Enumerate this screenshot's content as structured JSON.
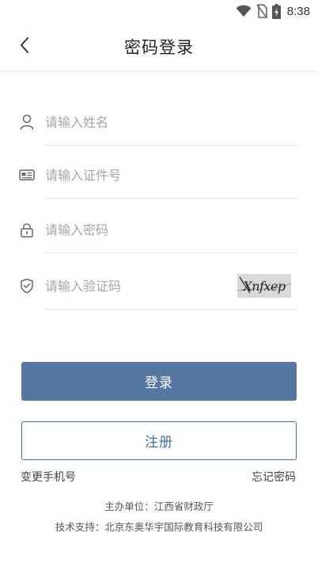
{
  "status_bar": {
    "time": "8:38",
    "icons": [
      "wifi-icon",
      "no-sim-icon",
      "battery-charging-icon"
    ]
  },
  "header": {
    "back_icon": "chevron-left-icon",
    "title": "密码登录"
  },
  "form": {
    "name": {
      "icon": "user-icon",
      "placeholder": "请输入姓名",
      "value": ""
    },
    "id_number": {
      "icon": "id-card-icon",
      "placeholder": "请输入证件号",
      "value": ""
    },
    "password": {
      "icon": "lock-icon",
      "placeholder": "请输入密码",
      "value": ""
    },
    "captcha": {
      "icon": "shield-check-icon",
      "placeholder": "请输入验证码",
      "value": "",
      "captcha_text": "Xnfxep"
    }
  },
  "buttons": {
    "login_label": "登录",
    "register_label": "注册"
  },
  "links": {
    "change_phone": "变更手机号",
    "forgot_password": "忘记密码"
  },
  "footer": {
    "host": "主办单位：江西省财政厅",
    "support": "技术支持：北京东奥华宇国际教育科技有限公司"
  },
  "colors": {
    "primary": "#5577a2",
    "register_text": "#4a6d99",
    "placeholder": "#a6a6a6"
  }
}
